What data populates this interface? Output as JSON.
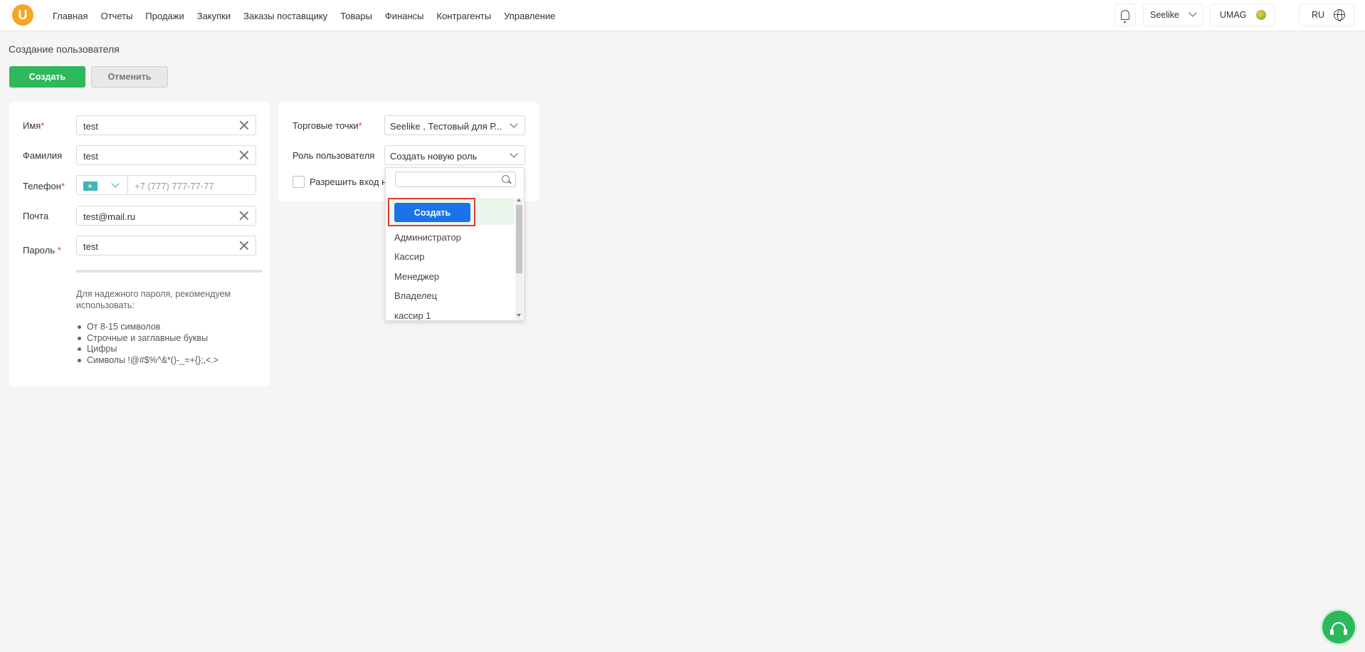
{
  "nav": {
    "logo_letter": "U",
    "items": [
      "Главная",
      "Отчеты",
      "Продажи",
      "Закупки",
      "Заказы поставщику",
      "Товары",
      "Финансы",
      "Контрагенты",
      "Управление"
    ],
    "store": "Seelike",
    "account": "UMAG",
    "language": "RU"
  },
  "page": {
    "title": "Создание пользователя",
    "create_label": "Создать",
    "cancel_label": "Отменить"
  },
  "form": {
    "first_name": {
      "label": "Имя",
      "value": "test"
    },
    "last_name": {
      "label": "Фамилия",
      "value": "test"
    },
    "phone": {
      "label": "Телефон",
      "placeholder": "+7 (777) 777-77-77"
    },
    "email": {
      "label": "Почта",
      "value": "test@mail.ru"
    },
    "password": {
      "label": "Пароль",
      "value": "test"
    },
    "required_mark": "*",
    "hint": "Для надежного пароля, рекомендуем использовать:",
    "hint_items": [
      "От 8-15 символов",
      "Строчные и заглавные буквы",
      "Цифры",
      "Символы !@#$%^&*()-_=+{};,<.>"
    ]
  },
  "settings": {
    "stores": {
      "label": "Торговые точки",
      "value": "Seelike , Тестовый для Р..."
    },
    "role": {
      "label": "Роль пользователя",
      "value": "Создать новую роль"
    },
    "allow_login_label": "Разрешить вход н"
  },
  "role_dropdown": {
    "create_label": "Создать",
    "options": [
      "Администратор",
      "Кассир",
      "Менеджер",
      "Владелец",
      "кассир 1"
    ]
  },
  "colors": {
    "primary_green": "#2eb85c",
    "blue": "#1a73e8",
    "highlight_red": "#e53935"
  }
}
